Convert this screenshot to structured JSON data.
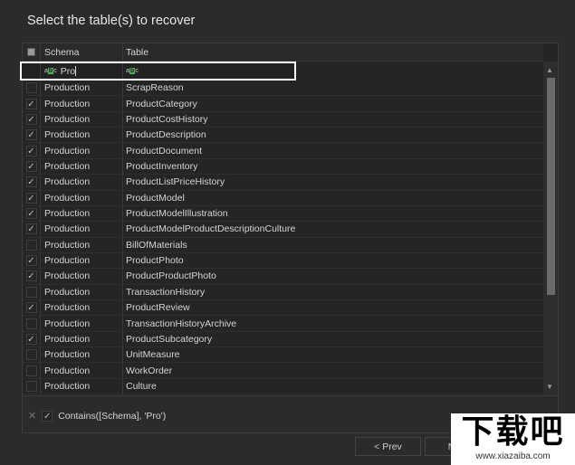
{
  "title": "Select the table(s) to recover",
  "columns": {
    "schema": "Schema",
    "table": "Table"
  },
  "filter_row": {
    "schema_value": "Pro",
    "table_value": ""
  },
  "rows": [
    {
      "schema": "Production",
      "table": "ScrapReason",
      "checked": false
    },
    {
      "schema": "Production",
      "table": "ProductCategory",
      "checked": true
    },
    {
      "schema": "Production",
      "table": "ProductCostHistory",
      "checked": true
    },
    {
      "schema": "Production",
      "table": "ProductDescription",
      "checked": true
    },
    {
      "schema": "Production",
      "table": "ProductDocument",
      "checked": true
    },
    {
      "schema": "Production",
      "table": "ProductInventory",
      "checked": true
    },
    {
      "schema": "Production",
      "table": "ProductListPriceHistory",
      "checked": true
    },
    {
      "schema": "Production",
      "table": "ProductModel",
      "checked": true
    },
    {
      "schema": "Production",
      "table": "ProductModelIllustration",
      "checked": true
    },
    {
      "schema": "Production",
      "table": "ProductModelProductDescriptionCulture",
      "checked": true
    },
    {
      "schema": "Production",
      "table": "BillOfMaterials",
      "checked": false
    },
    {
      "schema": "Production",
      "table": "ProductPhoto",
      "checked": true
    },
    {
      "schema": "Production",
      "table": "ProductProductPhoto",
      "checked": true
    },
    {
      "schema": "Production",
      "table": "TransactionHistory",
      "checked": false
    },
    {
      "schema": "Production",
      "table": "ProductReview",
      "checked": true
    },
    {
      "schema": "Production",
      "table": "TransactionHistoryArchive",
      "checked": false
    },
    {
      "schema": "Production",
      "table": "ProductSubcategory",
      "checked": true
    },
    {
      "schema": "Production",
      "table": "UnitMeasure",
      "checked": false
    },
    {
      "schema": "Production",
      "table": "WorkOrder",
      "checked": false
    },
    {
      "schema": "Production",
      "table": "Culture",
      "checked": false
    }
  ],
  "filter_expression": "Contains([Schema], 'Pro')",
  "buttons": {
    "prev": "< Prev",
    "next": "Next"
  },
  "watermark": {
    "text": "下载吧",
    "url": "www.xiazaiba.com"
  }
}
